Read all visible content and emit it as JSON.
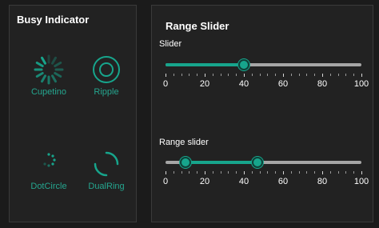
{
  "busy": {
    "title": "Busy Indicator",
    "items": [
      {
        "label": "Cupetino",
        "icon": "cupertino-spinner-icon"
      },
      {
        "label": "Ripple",
        "icon": "ripple-icon"
      },
      {
        "label": "DotCircle",
        "icon": "dot-circle-icon"
      },
      {
        "label": "DualRing",
        "icon": "dual-ring-icon"
      }
    ]
  },
  "range": {
    "title": "Range Slider",
    "slider": {
      "label": "Slider",
      "min": 0,
      "max": 100,
      "value": 40
    },
    "range_slider": {
      "label": "Range slider",
      "min": 0,
      "max": 100,
      "start": 10,
      "end": 47
    },
    "tick_labels": [
      "0",
      "20",
      "40",
      "60",
      "80",
      "100"
    ]
  },
  "colors": {
    "accent": "#17a58c",
    "accent_text": "#25a68f",
    "track": "#a6a6a6",
    "background": "#1b1b1b",
    "panel": "#222222"
  }
}
